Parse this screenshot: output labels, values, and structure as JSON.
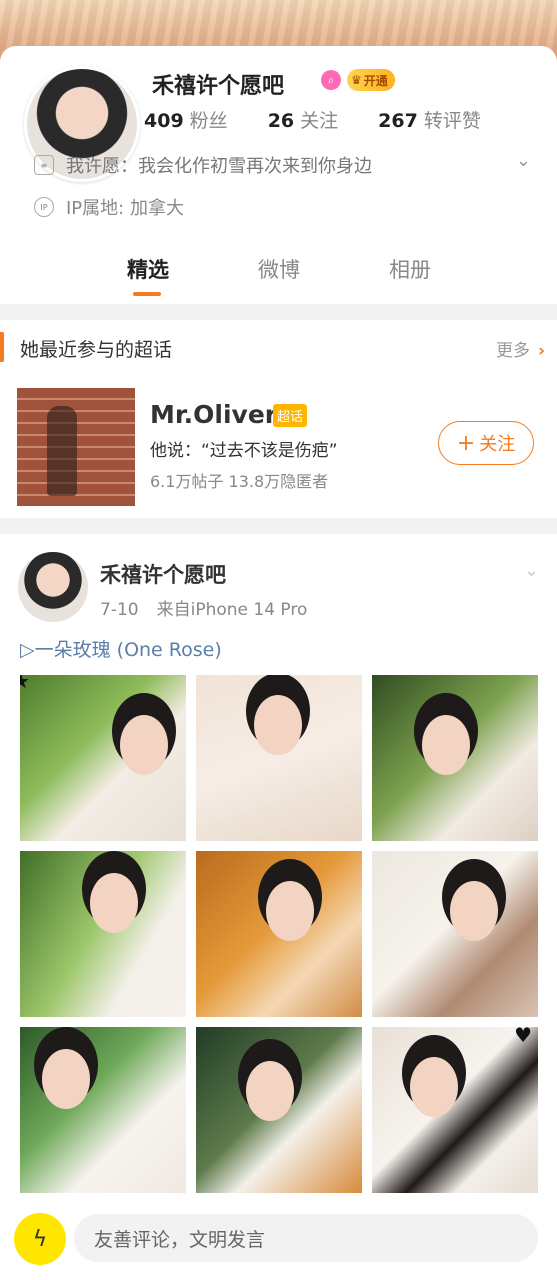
{
  "profile": {
    "name": "禾禧许个愿吧",
    "vip_label": "开通",
    "stats": [
      {
        "num": "409",
        "label": "粉丝"
      },
      {
        "num": "26",
        "label": "关注"
      },
      {
        "num": "267",
        "label": "转评赞"
      }
    ],
    "wish": "我许愿：我会化作初雪再次来到你身边",
    "ip": "IP属地: 加拿大",
    "ip_icon": "IP"
  },
  "tabs": [
    "精选",
    "微博",
    "相册"
  ],
  "super_topic": {
    "section_title": "她最近参与的超话",
    "more": "更多",
    "name": "Mr.Oliver",
    "badge": "超话",
    "quote": "他说：“过去不该是伤疤”",
    "stats": "6.1万帖子 13.8万隐匿者",
    "follow": "关注"
  },
  "post": {
    "author": "禾禧许个愿吧",
    "date": "7-10",
    "source": "来自iPhone 14 Pro",
    "song": "▷一朵玫瑰 (One Rose)",
    "photos": [
      "photo-1",
      "photo-2",
      "photo-3",
      "photo-4",
      "photo-5",
      "photo-6",
      "photo-7",
      "photo-8",
      "photo-9"
    ]
  },
  "comment": {
    "placeholder": "友善评论，文明发言"
  },
  "colors": {
    "accent": "#f47c1e",
    "link": "#5b7fa6",
    "vip": "#ffb11f",
    "badge_pink": "#ff6ab7"
  }
}
